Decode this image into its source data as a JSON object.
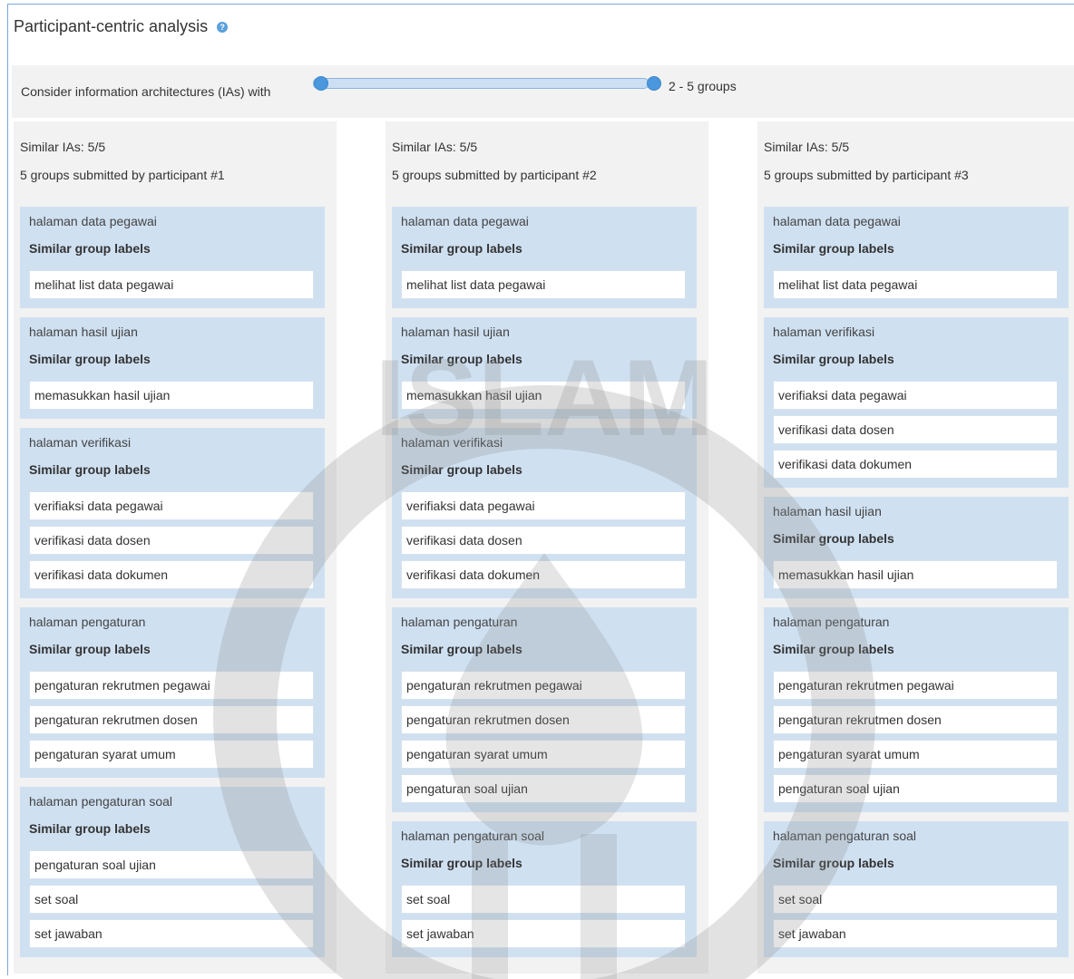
{
  "header": {
    "title": "Participant-centric analysis"
  },
  "filter": {
    "label": "Consider information architectures (IAs) with",
    "value": "2 - 5 groups"
  },
  "columns": [
    {
      "similar": "Similar IAs: 5/5",
      "submitted": "5 groups submitted by participant #1",
      "groups": [
        {
          "title": "halaman data pegawai",
          "heading": "Similar group labels",
          "labels": [
            "melihat list data pegawai"
          ]
        },
        {
          "title": "halaman hasil ujian",
          "heading": "Similar group labels",
          "labels": [
            "memasukkan hasil ujian"
          ]
        },
        {
          "title": "halaman verifikasi",
          "heading": "Similar group labels",
          "labels": [
            "verifiaksi data pegawai",
            "verifikasi data dosen",
            "verifikasi data dokumen"
          ]
        },
        {
          "title": "halaman pengaturan",
          "heading": "Similar group labels",
          "labels": [
            "pengaturan rekrutmen pegawai",
            "pengaturan rekrutmen dosen",
            "pengaturan syarat umum"
          ]
        },
        {
          "title": "halaman pengaturan soal",
          "heading": "Similar group labels",
          "labels": [
            "pengaturan soal ujian",
            "set soal",
            "set jawaban"
          ]
        }
      ]
    },
    {
      "similar": "Similar IAs: 5/5",
      "submitted": "5 groups submitted by participant #2",
      "groups": [
        {
          "title": "halaman data pegawai",
          "heading": "Similar group labels",
          "labels": [
            "melihat list data pegawai"
          ]
        },
        {
          "title": "halaman hasil ujian",
          "heading": "Similar group labels",
          "labels": [
            "memasukkan hasil ujian"
          ]
        },
        {
          "title": "halaman verifikasi",
          "heading": "Similar group labels",
          "labels": [
            "verifiaksi data pegawai",
            "verifikasi data dosen",
            "verifikasi data dokumen"
          ]
        },
        {
          "title": "halaman pengaturan",
          "heading": "Similar group labels",
          "labels": [
            "pengaturan rekrutmen pegawai",
            "pengaturan rekrutmen dosen",
            "pengaturan syarat umum",
            "pengaturan soal ujian"
          ]
        },
        {
          "title": "halaman pengaturan soal",
          "heading": "Similar group labels",
          "labels": [
            "set soal",
            "set jawaban"
          ]
        }
      ]
    },
    {
      "similar": "Similar IAs: 5/5",
      "submitted": "5 groups submitted by participant #3",
      "groups": [
        {
          "title": "halaman data pegawai",
          "heading": "Similar group labels",
          "labels": [
            "melihat list data pegawai"
          ]
        },
        {
          "title": "halaman verifikasi",
          "heading": "Similar group labels",
          "labels": [
            "verifiaksi data pegawai",
            "verifikasi data dosen",
            "verifikasi data dokumen"
          ]
        },
        {
          "title": "halaman hasil ujian",
          "heading": "Similar group labels",
          "labels": [
            "memasukkan hasil ujian"
          ]
        },
        {
          "title": "halaman pengaturan",
          "heading": "Similar group labels",
          "labels": [
            "pengaturan rekrutmen pegawai",
            "pengaturan rekrutmen dosen",
            "pengaturan syarat umum",
            "pengaturan soal ujian"
          ]
        },
        {
          "title": "halaman pengaturan soal",
          "heading": "Similar group labels",
          "labels": [
            "set soal",
            "set jawaban"
          ]
        }
      ]
    }
  ],
  "watermark": {
    "text": "ISLAM"
  }
}
